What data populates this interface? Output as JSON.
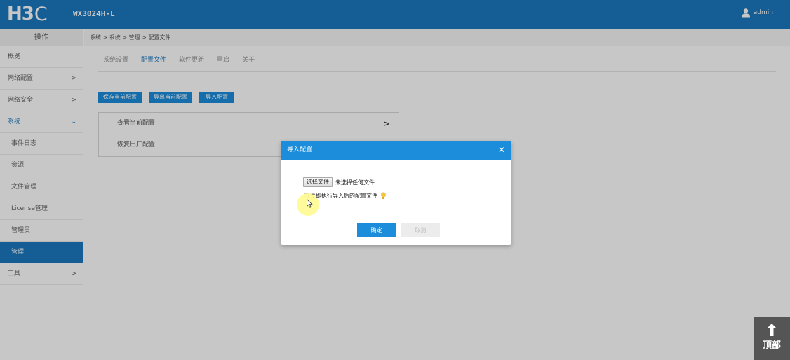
{
  "header": {
    "logo_main": "H3",
    "logo_c": "C",
    "model": "WX3024H-L",
    "user": "admin"
  },
  "sidebar": {
    "title": "操作",
    "items": [
      {
        "label": "概览"
      },
      {
        "label": "网络配置",
        "chevron": ">"
      },
      {
        "label": "网络安全",
        "chevron": ">"
      },
      {
        "label": "系统",
        "chevron": "⌄"
      },
      {
        "label": "事件日志"
      },
      {
        "label": "资源"
      },
      {
        "label": "文件管理"
      },
      {
        "label": "License管理"
      },
      {
        "label": "管理员"
      },
      {
        "label": "管理"
      },
      {
        "label": "工具",
        "chevron": ">"
      }
    ]
  },
  "main": {
    "breadcrumb": "系统 > 系统 > 管理 > 配置文件",
    "tabs": [
      {
        "label": "系统设置"
      },
      {
        "label": "配置文件"
      },
      {
        "label": "软件更新"
      },
      {
        "label": "重启"
      },
      {
        "label": "关于"
      }
    ],
    "buttons": {
      "save": "保存当前配置",
      "export": "导出当前配置",
      "import": "导入配置"
    },
    "config_rows": [
      {
        "label": "查看当前配置",
        "chevron": ">"
      },
      {
        "label": "恢复出厂配置"
      }
    ]
  },
  "dialog": {
    "title": "导入配置",
    "close": "✕",
    "file_button": "选择文件",
    "file_status": "未选择任何文件",
    "checkbox_label": "立即执行导入后的配置文件",
    "ok": "确定",
    "cancel": "取消"
  },
  "back_to_top": {
    "label": "顶部"
  },
  "colors": {
    "brand": "#1c79bf",
    "button": "#1c8ddb",
    "hint": "#f5c542"
  }
}
